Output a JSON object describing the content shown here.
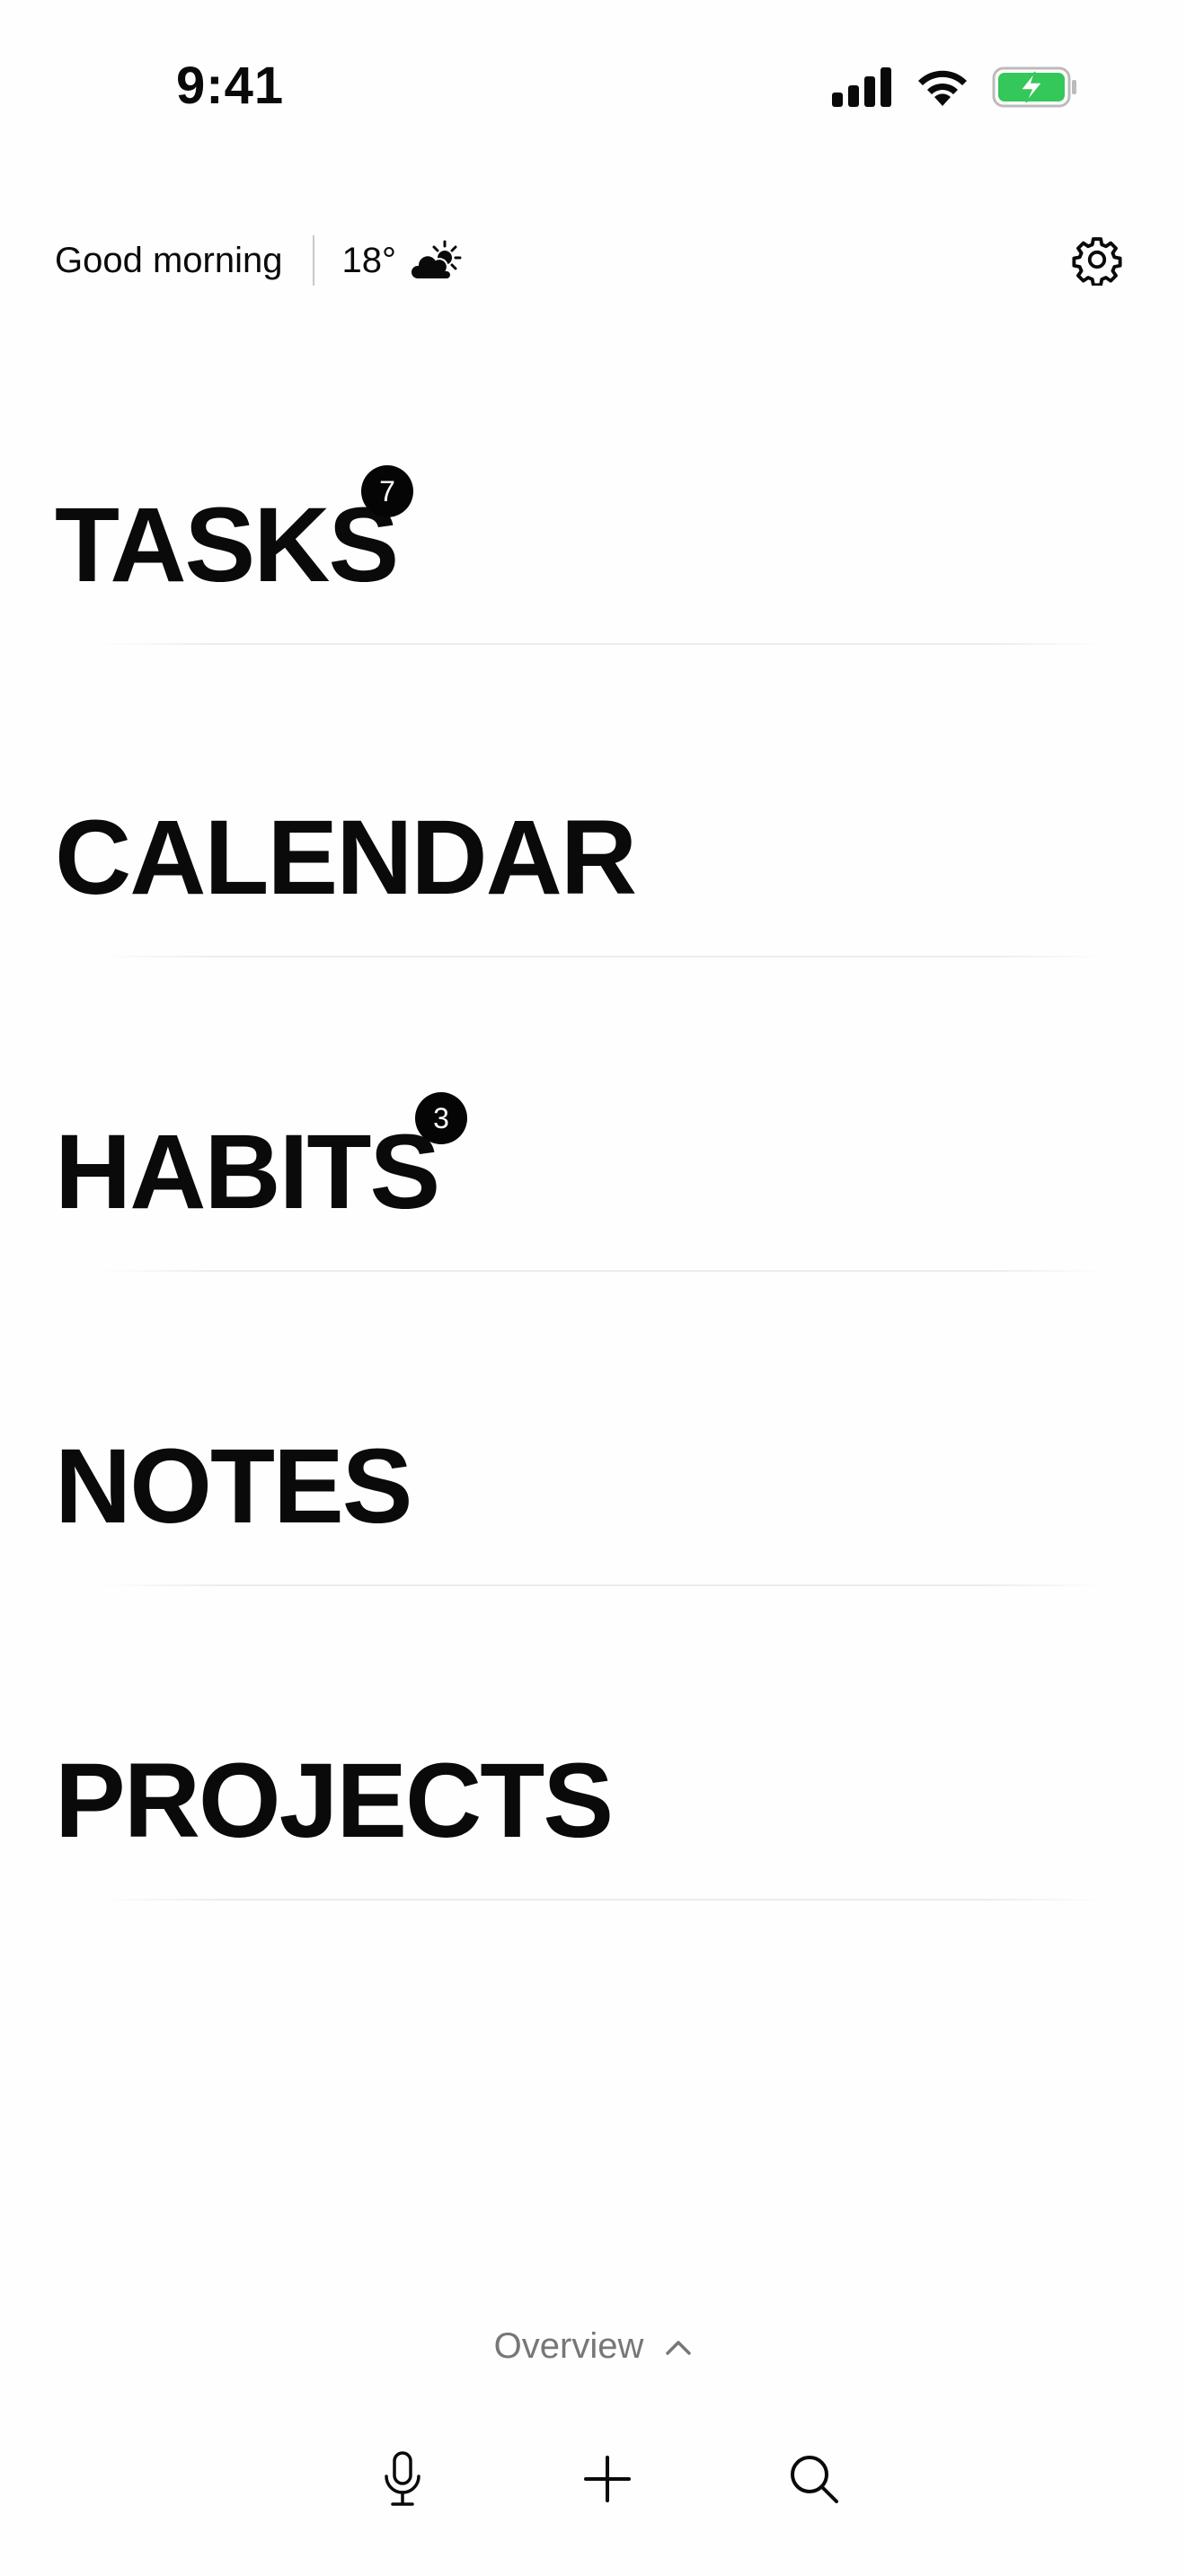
{
  "status_bar": {
    "time": "9:41",
    "icons": [
      "signal-icon",
      "wifi-icon",
      "battery-charging-icon"
    ],
    "battery_color": "#34c759"
  },
  "header": {
    "greeting": "Good morning",
    "temperature": "18°",
    "weather_icon": "partly-sunny-icon",
    "settings_icon": "gear-icon"
  },
  "sections": [
    {
      "label": "TASKS",
      "badge": "7"
    },
    {
      "label": "CALENDAR",
      "badge": ""
    },
    {
      "label": "HABITS",
      "badge": "3"
    },
    {
      "label": "NOTES",
      "badge": ""
    },
    {
      "label": "PROJECTS",
      "badge": ""
    }
  ],
  "footer": {
    "overview_label": "Overview",
    "overview_icon": "chevron-up-icon",
    "tools": [
      "microphone-icon",
      "plus-icon",
      "search-icon"
    ]
  }
}
